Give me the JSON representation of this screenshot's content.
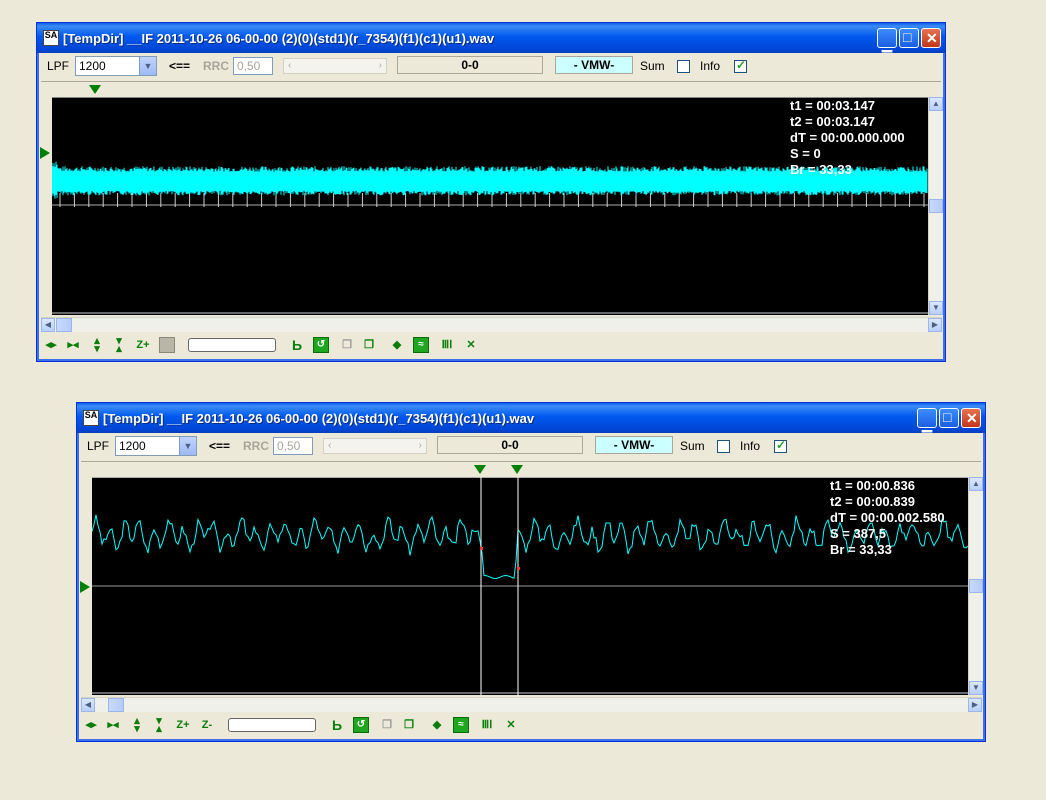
{
  "windows": [
    {
      "title": "[TempDir] __IF 2011-10-26 06-00-00 (2)(0)(std1)(r_7354)(f1)(c1)(u1).wav",
      "app_icon_text": "SA",
      "toolbar": {
        "lpf_label": "LPF",
        "lpf_value": "1200",
        "arrow_label": "<==",
        "rrc_label": "RRC",
        "rrc_value": "0,50",
        "position_text": "0-0",
        "vmw_label": "- VMW-",
        "sum_label": "Sum",
        "sum_checked": false,
        "info_label": "Info",
        "info_checked": true
      },
      "info": {
        "t1": "t1 = 00:03.147",
        "t2": "t2 = 00:03.147",
        "dt": "dT = 00:00.000.000",
        "s": "S = 0",
        "br": "Br = 33,33"
      },
      "bottom_icons": [
        "move-horizontal-icon",
        "zoom-fit-horizontal-icon",
        "move-vertical-icon",
        "zoom-fit-vertical-icon",
        "zoom-in-icon",
        "blank-square-icon",
        "progress-bar",
        "marker-icon",
        "refresh-icon",
        "copy-disabled-icon",
        "copy-icon",
        "diamond-icon",
        "wave-icon",
        "comb-icon",
        "cross-arrows-icon"
      ],
      "zoom_in_label": "Z+"
    },
    {
      "title": "[TempDir] __IF 2011-10-26 06-00-00 (2)(0)(std1)(r_7354)(f1)(c1)(u1).wav",
      "app_icon_text": "SA",
      "toolbar": {
        "lpf_label": "LPF",
        "lpf_value": "1200",
        "arrow_label": "<==",
        "rrc_label": "RRC",
        "rrc_value": "0,50",
        "position_text": "0-0",
        "vmw_label": "- VMW-",
        "sum_label": "Sum",
        "sum_checked": false,
        "info_label": "Info",
        "info_checked": true
      },
      "info": {
        "t1": "t1 = 00:00.836",
        "t2": "t2 = 00:00.839",
        "dt": "dT = 00:00.002.580",
        "s": "S = 387,5",
        "br": "Br = 33,33"
      },
      "zoom_in_label": "Z+",
      "zoom_out_label": "Z-"
    }
  ],
  "colors": {
    "waveform": "#00ffff",
    "plot_background": "#000000",
    "marker": "#008000",
    "titlebar": "#0058ee"
  }
}
